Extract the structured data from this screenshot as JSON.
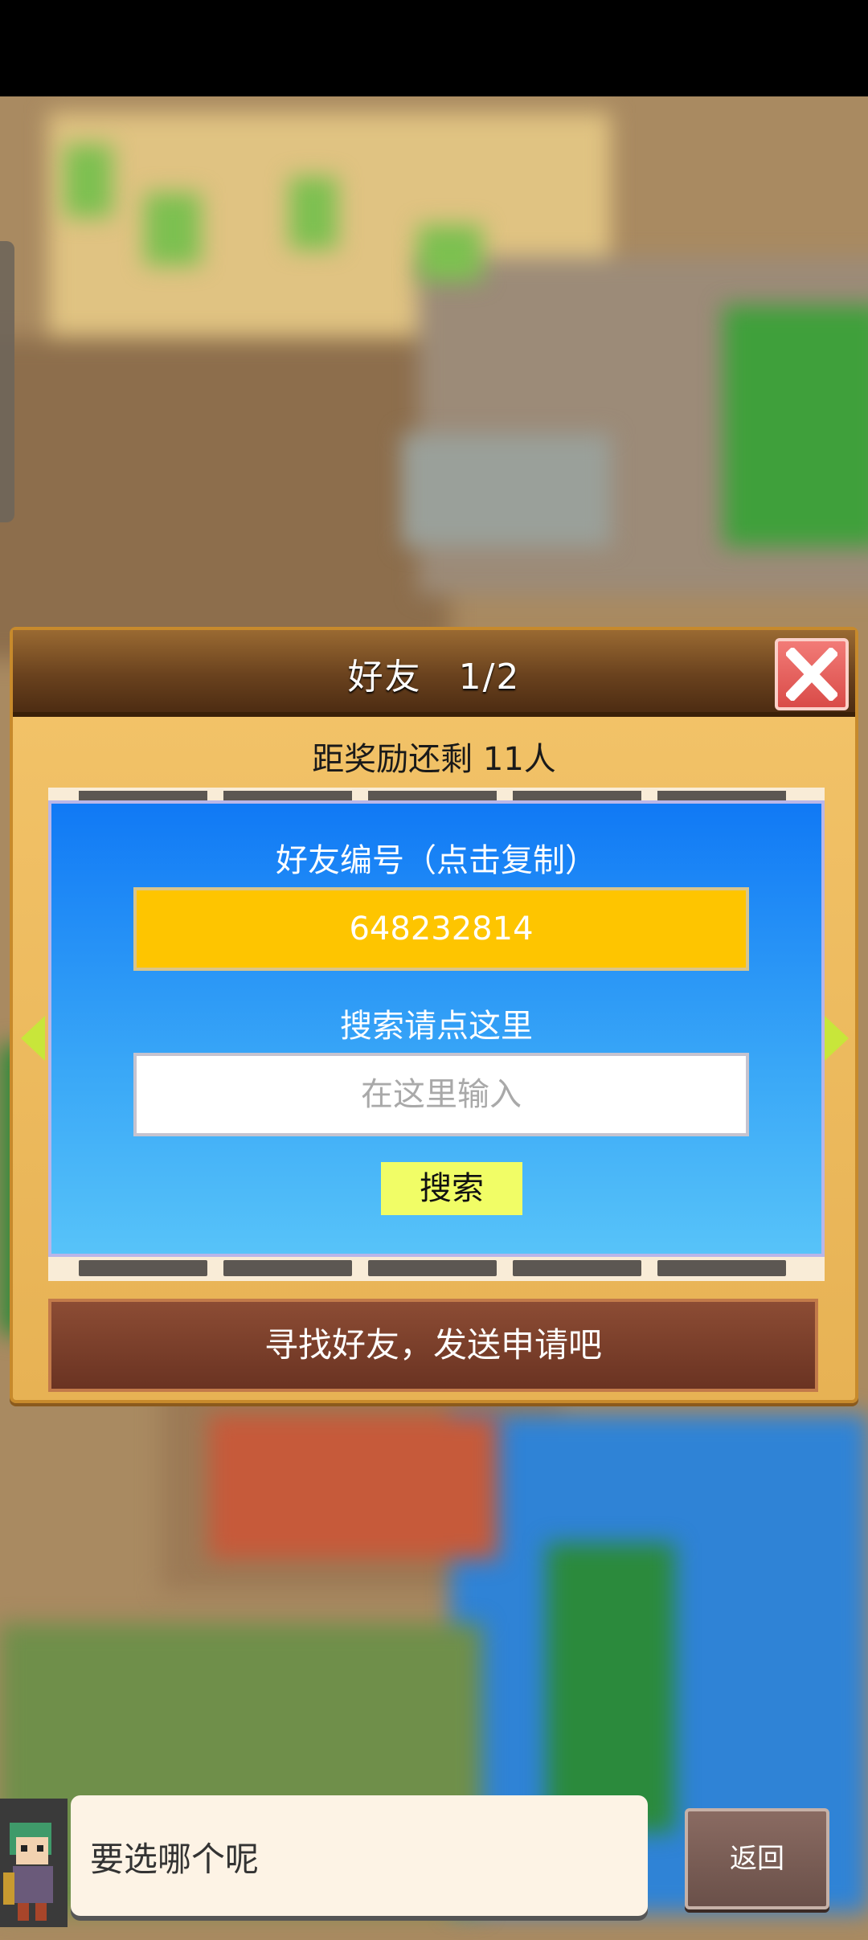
{
  "dialog": {
    "title": "好友　1/2",
    "reward_text": "距奖励还剩 11人",
    "friend_id_label": "好友编号（点击复制）",
    "friend_id": "648232814",
    "search_label": "搜索请点这里",
    "search_placeholder": "在这里输入",
    "search_button": "搜索",
    "find_friends": "寻找好友，发送申请吧"
  },
  "assistant": {
    "message": "要选哪个呢"
  },
  "back_button": "返回",
  "colors": {
    "panel_blue": "#1079f5",
    "id_box_yellow": "#fec500",
    "search_button_yellow": "#f1fd66",
    "close_red": "#e5534f",
    "find_bar_brown": "#7a3f2b"
  },
  "icons": {
    "close": "close-x-icon",
    "prev": "arrow-left-icon",
    "next": "arrow-right-icon"
  }
}
